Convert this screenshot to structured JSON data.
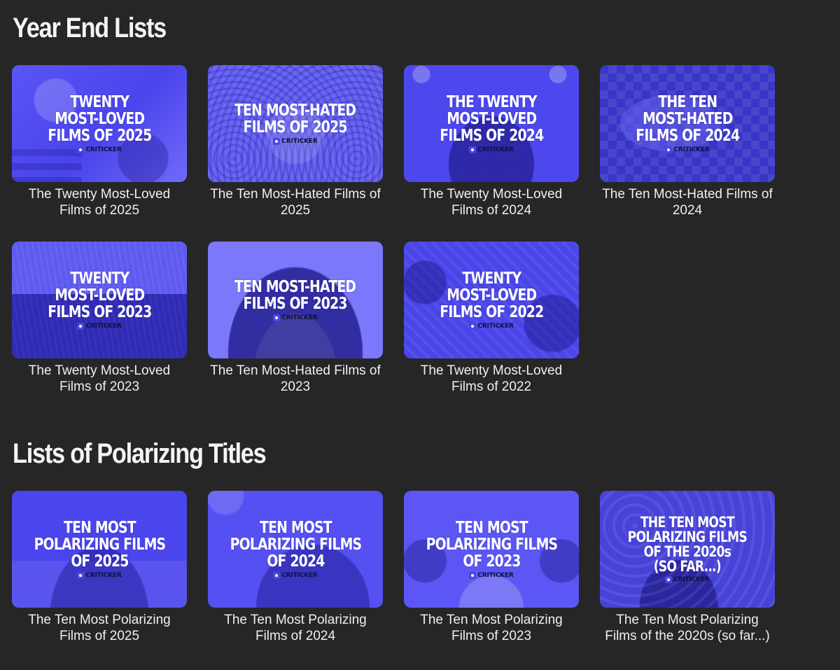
{
  "sections": [
    {
      "title": "Year End Lists",
      "cards": [
        {
          "thumb_text": "TWENTY\nMOST-LOVED\nFILMS OF 2025",
          "caption": "The Twenty Most-Loved Films of 2025"
        },
        {
          "thumb_text": "TEN MOST-HATED\nFILMS OF 2025",
          "caption": "The Ten Most-Hated Films of 2025"
        },
        {
          "thumb_text": "THE TWENTY\nMOST-LOVED\nFILMS OF 2024",
          "caption": "The Twenty Most-Loved Films of 2024"
        },
        {
          "thumb_text": "THE TEN\nMOST-HATED\nFILMS OF 2024",
          "caption": "The Ten Most-Hated Films of 2024"
        },
        {
          "thumb_text": "TWENTY\nMOST-LOVED\nFILMS OF 2023",
          "caption": "The Twenty Most-Loved Films of 2023"
        },
        {
          "thumb_text": "TEN MOST-HATED\nFILMS OF 2023",
          "caption": "The Ten Most-Hated Films of 2023"
        },
        {
          "thumb_text": "TWENTY\nMOST-LOVED\nFILMS OF 2022",
          "caption": "The Twenty Most-Loved Films of 2022"
        }
      ]
    },
    {
      "title": "Lists of Polarizing Titles",
      "cards": [
        {
          "thumb_text": "TEN MOST\nPOLARIZING FILMS\nOF 2025",
          "caption": "The Ten Most Polarizing Films of 2025"
        },
        {
          "thumb_text": "TEN MOST\nPOLARIZING FILMS\nOF 2024",
          "caption": "The Ten Most Polarizing Films of 2024"
        },
        {
          "thumb_text": "TEN MOST\nPOLARIZING FILMS\nOF 2023",
          "caption": "The Ten Most Polarizing Films of 2023"
        },
        {
          "thumb_text": "THE TEN MOST\nPOLARIZING FILMS\nOF THE 2020s\n(SO FAR...)",
          "caption": "The Ten Most Polarizing Films of the 2020s (so far...)"
        }
      ]
    }
  ],
  "brand_label": "CRITICKER",
  "colors": {
    "background": "#262626",
    "accent": "#5a55f5",
    "text": "#f0f0f0"
  }
}
